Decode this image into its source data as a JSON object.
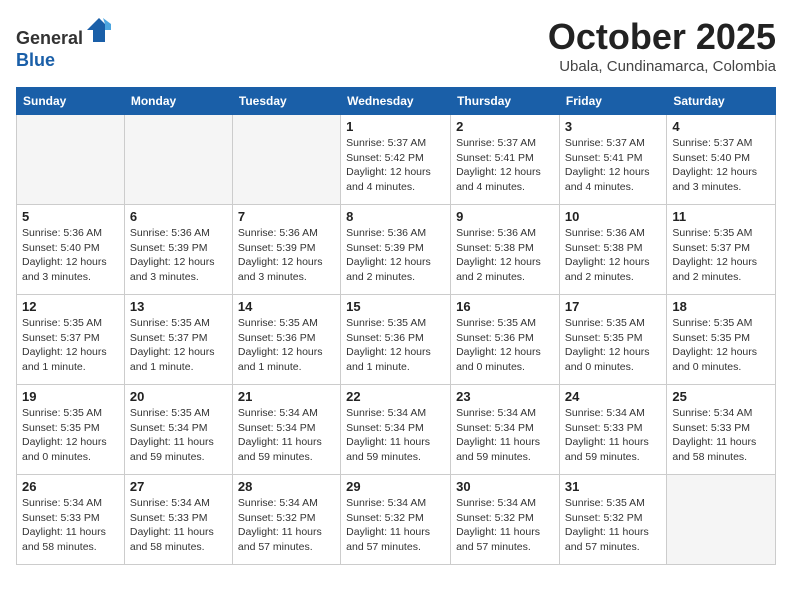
{
  "header": {
    "logo_line1": "General",
    "logo_line2": "Blue",
    "month": "October 2025",
    "location": "Ubala, Cundinamarca, Colombia"
  },
  "days_of_week": [
    "Sunday",
    "Monday",
    "Tuesday",
    "Wednesday",
    "Thursday",
    "Friday",
    "Saturday"
  ],
  "weeks": [
    [
      {
        "day": "",
        "info": ""
      },
      {
        "day": "",
        "info": ""
      },
      {
        "day": "",
        "info": ""
      },
      {
        "day": "1",
        "info": "Sunrise: 5:37 AM\nSunset: 5:42 PM\nDaylight: 12 hours\nand 4 minutes."
      },
      {
        "day": "2",
        "info": "Sunrise: 5:37 AM\nSunset: 5:41 PM\nDaylight: 12 hours\nand 4 minutes."
      },
      {
        "day": "3",
        "info": "Sunrise: 5:37 AM\nSunset: 5:41 PM\nDaylight: 12 hours\nand 4 minutes."
      },
      {
        "day": "4",
        "info": "Sunrise: 5:37 AM\nSunset: 5:40 PM\nDaylight: 12 hours\nand 3 minutes."
      }
    ],
    [
      {
        "day": "5",
        "info": "Sunrise: 5:36 AM\nSunset: 5:40 PM\nDaylight: 12 hours\nand 3 minutes."
      },
      {
        "day": "6",
        "info": "Sunrise: 5:36 AM\nSunset: 5:39 PM\nDaylight: 12 hours\nand 3 minutes."
      },
      {
        "day": "7",
        "info": "Sunrise: 5:36 AM\nSunset: 5:39 PM\nDaylight: 12 hours\nand 3 minutes."
      },
      {
        "day": "8",
        "info": "Sunrise: 5:36 AM\nSunset: 5:39 PM\nDaylight: 12 hours\nand 2 minutes."
      },
      {
        "day": "9",
        "info": "Sunrise: 5:36 AM\nSunset: 5:38 PM\nDaylight: 12 hours\nand 2 minutes."
      },
      {
        "day": "10",
        "info": "Sunrise: 5:36 AM\nSunset: 5:38 PM\nDaylight: 12 hours\nand 2 minutes."
      },
      {
        "day": "11",
        "info": "Sunrise: 5:35 AM\nSunset: 5:37 PM\nDaylight: 12 hours\nand 2 minutes."
      }
    ],
    [
      {
        "day": "12",
        "info": "Sunrise: 5:35 AM\nSunset: 5:37 PM\nDaylight: 12 hours\nand 1 minute."
      },
      {
        "day": "13",
        "info": "Sunrise: 5:35 AM\nSunset: 5:37 PM\nDaylight: 12 hours\nand 1 minute."
      },
      {
        "day": "14",
        "info": "Sunrise: 5:35 AM\nSunset: 5:36 PM\nDaylight: 12 hours\nand 1 minute."
      },
      {
        "day": "15",
        "info": "Sunrise: 5:35 AM\nSunset: 5:36 PM\nDaylight: 12 hours\nand 1 minute."
      },
      {
        "day": "16",
        "info": "Sunrise: 5:35 AM\nSunset: 5:36 PM\nDaylight: 12 hours\nand 0 minutes."
      },
      {
        "day": "17",
        "info": "Sunrise: 5:35 AM\nSunset: 5:35 PM\nDaylight: 12 hours\nand 0 minutes."
      },
      {
        "day": "18",
        "info": "Sunrise: 5:35 AM\nSunset: 5:35 PM\nDaylight: 12 hours\nand 0 minutes."
      }
    ],
    [
      {
        "day": "19",
        "info": "Sunrise: 5:35 AM\nSunset: 5:35 PM\nDaylight: 12 hours\nand 0 minutes."
      },
      {
        "day": "20",
        "info": "Sunrise: 5:35 AM\nSunset: 5:34 PM\nDaylight: 11 hours\nand 59 minutes."
      },
      {
        "day": "21",
        "info": "Sunrise: 5:34 AM\nSunset: 5:34 PM\nDaylight: 11 hours\nand 59 minutes."
      },
      {
        "day": "22",
        "info": "Sunrise: 5:34 AM\nSunset: 5:34 PM\nDaylight: 11 hours\nand 59 minutes."
      },
      {
        "day": "23",
        "info": "Sunrise: 5:34 AM\nSunset: 5:34 PM\nDaylight: 11 hours\nand 59 minutes."
      },
      {
        "day": "24",
        "info": "Sunrise: 5:34 AM\nSunset: 5:33 PM\nDaylight: 11 hours\nand 59 minutes."
      },
      {
        "day": "25",
        "info": "Sunrise: 5:34 AM\nSunset: 5:33 PM\nDaylight: 11 hours\nand 58 minutes."
      }
    ],
    [
      {
        "day": "26",
        "info": "Sunrise: 5:34 AM\nSunset: 5:33 PM\nDaylight: 11 hours\nand 58 minutes."
      },
      {
        "day": "27",
        "info": "Sunrise: 5:34 AM\nSunset: 5:33 PM\nDaylight: 11 hours\nand 58 minutes."
      },
      {
        "day": "28",
        "info": "Sunrise: 5:34 AM\nSunset: 5:32 PM\nDaylight: 11 hours\nand 57 minutes."
      },
      {
        "day": "29",
        "info": "Sunrise: 5:34 AM\nSunset: 5:32 PM\nDaylight: 11 hours\nand 57 minutes."
      },
      {
        "day": "30",
        "info": "Sunrise: 5:34 AM\nSunset: 5:32 PM\nDaylight: 11 hours\nand 57 minutes."
      },
      {
        "day": "31",
        "info": "Sunrise: 5:35 AM\nSunset: 5:32 PM\nDaylight: 11 hours\nand 57 minutes."
      },
      {
        "day": "",
        "info": ""
      }
    ]
  ]
}
